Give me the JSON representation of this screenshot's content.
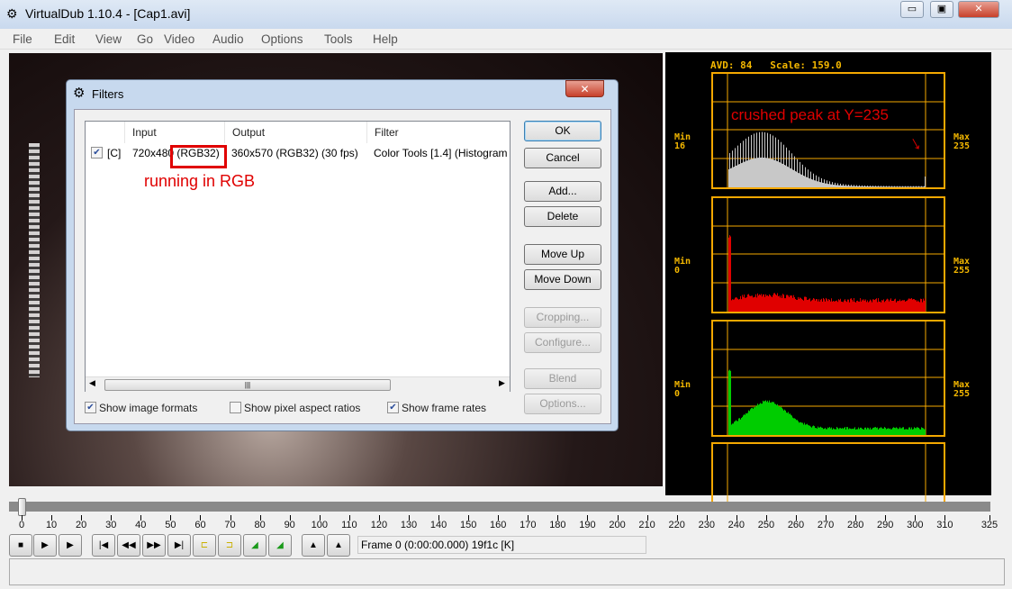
{
  "window": {
    "title": "VirtualDub 1.10.4 - [Cap1.avi]",
    "minimize": "▭",
    "restore": "▣",
    "close": "✕"
  },
  "menu": [
    "File",
    "Edit",
    "View",
    "Go",
    "Video",
    "Audio",
    "Options",
    "Tools",
    "Help"
  ],
  "histogram": {
    "header": "AVD: 84   Scale: 159.0",
    "panels": [
      {
        "min_label": "Min",
        "min": "16",
        "max_label": "Max",
        "max": "235",
        "color": "#c8c8c8"
      },
      {
        "min_label": "Min",
        "min": "0",
        "max_label": "Max",
        "max": "255",
        "color": "#e00000"
      },
      {
        "min_label": "Min",
        "min": "0",
        "max_label": "Max",
        "max": "255",
        "color": "#00cc00"
      }
    ],
    "annotation": "crushed peak at Y=235",
    "accent": "#f5a800"
  },
  "dialog": {
    "title": "Filters",
    "close": "✕",
    "columns": [
      "Input",
      "Output",
      "Filter"
    ],
    "rows": [
      {
        "checked": true,
        "flag": "[C]",
        "input": "720x480 (RGB32)",
        "output": "360x570 (RGB32) (30 fps)",
        "filter": "Color Tools [1.4] (Histogram"
      }
    ],
    "annotation": "running in RGB",
    "buttons": {
      "ok": "OK",
      "cancel": "Cancel",
      "add": "Add...",
      "delete": "Delete",
      "move_up": "Move Up",
      "move_down": "Move Down",
      "cropping": "Cropping...",
      "configure": "Configure...",
      "blend": "Blend",
      "options": "Options..."
    },
    "checkboxes": [
      {
        "label": "Show image formats",
        "checked": true
      },
      {
        "label": "Show pixel aspect ratios",
        "checked": false
      },
      {
        "label": "Show frame rates",
        "checked": true
      }
    ]
  },
  "timeline": {
    "min": 0,
    "max": 325,
    "position": 0,
    "labels": [
      "0",
      "10",
      "20",
      "30",
      "40",
      "50",
      "60",
      "70",
      "80",
      "90",
      "100",
      "110",
      "120",
      "130",
      "140",
      "150",
      "160",
      "170",
      "180",
      "190",
      "200",
      "210",
      "220",
      "230",
      "240",
      "250",
      "260",
      "270",
      "280",
      "290",
      "300",
      "310",
      "325"
    ]
  },
  "status": {
    "frame": "Frame 0 (0:00:00.000) 19f1c [K]"
  }
}
